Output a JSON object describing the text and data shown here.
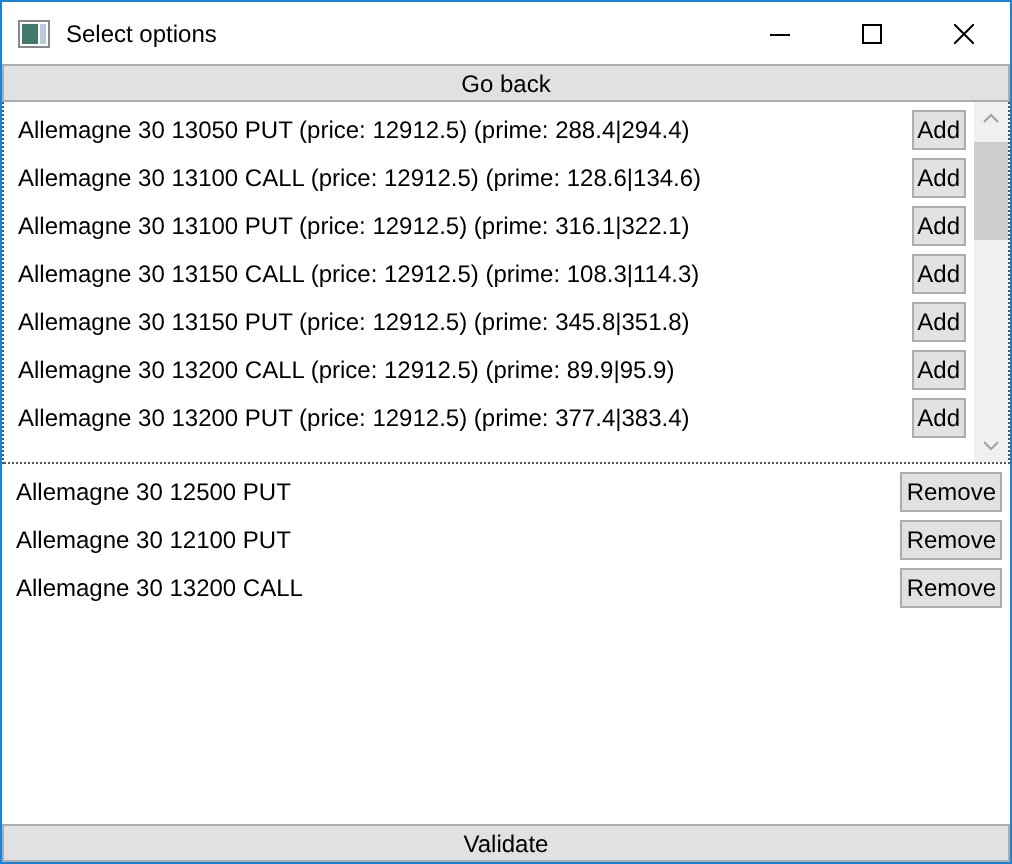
{
  "window": {
    "title": "Select options"
  },
  "go_back_button": "Go back",
  "available_options": [
    {
      "label": "Allemagne 30 13050 PUT (price: 12912.5) (prime: 288.4|294.4)",
      "button": "Add"
    },
    {
      "label": "Allemagne 30 13100 CALL (price: 12912.5) (prime: 128.6|134.6)",
      "button": "Add"
    },
    {
      "label": "Allemagne 30 13100 PUT (price: 12912.5) (prime: 316.1|322.1)",
      "button": "Add"
    },
    {
      "label": "Allemagne 30 13150 CALL (price: 12912.5) (prime: 108.3|114.3)",
      "button": "Add"
    },
    {
      "label": "Allemagne 30 13150 PUT (price: 12912.5) (prime: 345.8|351.8)",
      "button": "Add"
    },
    {
      "label": "Allemagne 30 13200 CALL (price: 12912.5) (prime: 89.9|95.9)",
      "button": "Add"
    },
    {
      "label": "Allemagne 30 13200 PUT (price: 12912.5) (prime: 377.4|383.4)",
      "button": "Add"
    }
  ],
  "selected_options": [
    {
      "label": "Allemagne 30 12500 PUT",
      "button": "Remove"
    },
    {
      "label": "Allemagne 30 12100 PUT",
      "button": "Remove"
    },
    {
      "label": "Allemagne 30 13200 CALL",
      "button": "Remove"
    }
  ],
  "validate_button": "Validate"
}
